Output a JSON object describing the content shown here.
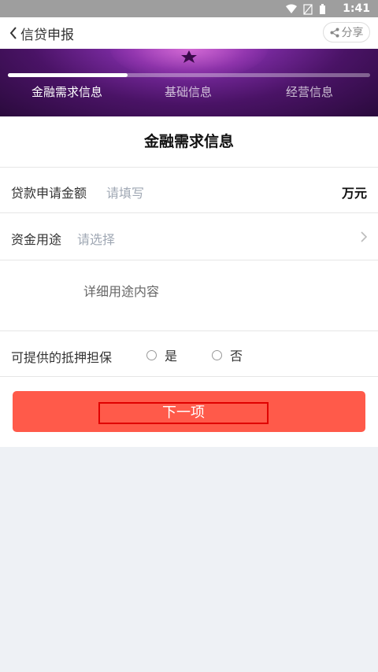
{
  "status_bar": {
    "time": "1:41",
    "icons": [
      "wifi-icon",
      "no-signal-icon",
      "battery-icon"
    ]
  },
  "navbar": {
    "back_label": "信贷申报",
    "share_label": "分享"
  },
  "steps": {
    "progress_fraction": 0.33,
    "items": [
      {
        "label": "金融需求信息",
        "active": true
      },
      {
        "label": "基础信息",
        "active": false
      },
      {
        "label": "经营信息",
        "active": false
      }
    ]
  },
  "form": {
    "title": "金融需求信息",
    "loan_amount": {
      "label": "贷款申请金额",
      "placeholder": "请填写",
      "unit": "万元"
    },
    "fund_usage": {
      "label": "资金用途",
      "placeholder": "请选择"
    },
    "usage_detail": {
      "placeholder": "详细用途内容"
    },
    "collateral": {
      "label": "可提供的抵押担保",
      "options": [
        "是",
        "否"
      ]
    },
    "next_button": "下一项"
  },
  "colors": {
    "accent": "#ff5a4a",
    "highlight_border": "#e00000",
    "banner": "#4a1366"
  }
}
